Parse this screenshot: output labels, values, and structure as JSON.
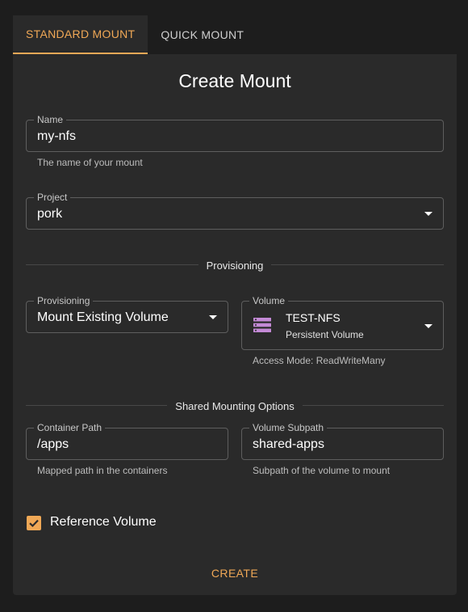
{
  "tabs": [
    {
      "label": "STANDARD MOUNT",
      "active": true
    },
    {
      "label": "QUICK MOUNT",
      "active": false
    }
  ],
  "form": {
    "title": "Create Mount",
    "name": {
      "label": "Name",
      "value": "my-nfs",
      "helper": "The name of your mount"
    },
    "project": {
      "label": "Project",
      "value": "pork"
    },
    "provisioning_section": "Provisioning",
    "provisioning": {
      "label": "Provisioning",
      "value": "Mount Existing Volume"
    },
    "volume": {
      "label": "Volume",
      "name": "TEST-NFS",
      "type": "Persistent Volume",
      "icon": "storage-icon",
      "access_mode": "Access Mode: ReadWriteMany"
    },
    "shared_section": "Shared Mounting Options",
    "container_path": {
      "label": "Container Path",
      "value": "/apps",
      "helper": "Mapped path in the containers"
    },
    "volume_subpath": {
      "label": "Volume Subpath",
      "value": "shared-apps",
      "helper": "Subpath of the volume to mount"
    },
    "reference_volume": {
      "label": "Reference Volume",
      "checked": true
    },
    "create_label": "CREATE"
  },
  "colors": {
    "accent": "#f0a856",
    "volume_icon": "#c48ad6",
    "background": "#1d1d1d",
    "card": "#2a2a2a"
  }
}
